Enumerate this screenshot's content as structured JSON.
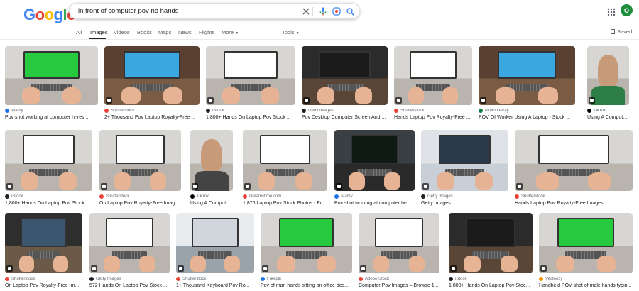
{
  "header": {
    "logo_letters": [
      {
        "ch": "G",
        "color": "#4285F4"
      },
      {
        "ch": "o",
        "color": "#EA4335"
      },
      {
        "ch": "o",
        "color": "#FBBC05"
      },
      {
        "ch": "g",
        "color": "#4285F4"
      },
      {
        "ch": "l",
        "color": "#34A853"
      },
      {
        "ch": "e",
        "color": "#EA4335"
      }
    ],
    "search_query": "in front of computer pov no hands",
    "avatar_letter": "O",
    "icons": [
      "clear-icon",
      "mic-icon",
      "lens-icon",
      "search-icon",
      "apps-icon"
    ]
  },
  "tabs": [
    {
      "label": "All",
      "active": false
    },
    {
      "label": "Images",
      "active": true
    },
    {
      "label": "Videos",
      "active": false
    },
    {
      "label": "Books",
      "active": false
    },
    {
      "label": "Maps",
      "active": false
    },
    {
      "label": "News",
      "active": false
    },
    {
      "label": "Flights",
      "active": false
    },
    {
      "label": "More",
      "active": false
    },
    {
      "label": "Tools",
      "active": false
    }
  ],
  "saved_label": "Saved",
  "rows": [
    {
      "cards": [
        {
          "source": "Alamy",
          "caption": "Pov shot working at computer hi-res ...",
          "scene": "green",
          "src_color": "#1a73e8"
        },
        {
          "source": "Shutterstock",
          "caption": "2+ Thousand Pov Laptop Royalty-Free ...",
          "scene": "blue",
          "src_color": "#ea4335"
        },
        {
          "source": "iStock",
          "caption": "1,800+ Hands On Laptop Pov Stock ...",
          "scene": "white",
          "src_color": "#202124"
        },
        {
          "source": "Getty Images",
          "caption": "Pov Desktop Computer Screen And ...",
          "scene": "dark",
          "src_color": "#202124"
        },
        {
          "source": "Shutterstock",
          "caption": "Hands Laptop Pov Royalty-Free ...",
          "scene": "white",
          "src_color": "#ea4335"
        },
        {
          "source": "Motion Array",
          "caption": "POV Of Worker Using A Laptop - Stock ...",
          "scene": "blue",
          "src_color": "#0b8043"
        },
        {
          "source": "TikTok",
          "caption": "Using A Computer ...",
          "scene": "person-green",
          "src_color": "#000000"
        }
      ]
    },
    {
      "cards": [
        {
          "source": "iStock",
          "caption": "1,800+ Hands On Laptop Pov Stock ...",
          "scene": "white",
          "src_color": "#202124"
        },
        {
          "source": "Shutterstock",
          "caption": "On Laptop Pov Royalty-Free Imag...",
          "scene": "white",
          "src_color": "#ea4335"
        },
        {
          "source": "TikTok",
          "caption": "Using A Computer ...",
          "scene": "person",
          "src_color": "#000000"
        },
        {
          "source": "Dreamstime.com",
          "caption": "1,876 Laptop Pov Stock Photos - Fr...",
          "scene": "white",
          "src_color": "#ea4335"
        },
        {
          "source": "Alamy",
          "caption": "Pov shot working at computer hi-...",
          "scene": "code",
          "src_color": "#1a73e8"
        },
        {
          "source": "Getty Images",
          "caption": "Getty Images",
          "scene": "silver",
          "src_color": "#202124"
        },
        {
          "source": "Shutterstock",
          "caption": "Hands Laptop Pov Royalty-Free Images ...",
          "scene": "white",
          "src_color": "#ea4335"
        }
      ]
    },
    {
      "cards": [
        {
          "source": "Shutterstock",
          "caption": "On Laptop Pov Royalty-Free Im...",
          "scene": "multi",
          "src_color": "#ea4335"
        },
        {
          "source": "Getty Images",
          "caption": "572 Hands On Laptop Pov Stock ...",
          "scene": "white",
          "src_color": "#202124"
        },
        {
          "source": "Shutterstock",
          "caption": "1+ Thousand Keyboard Pov Ro...",
          "scene": "desk",
          "src_color": "#ea4335"
        },
        {
          "source": "Freepik",
          "caption": "Pov of man hands sitting on office des...",
          "scene": "green",
          "src_color": "#1a73e8"
        },
        {
          "source": "Adobe Stock",
          "caption": "Computer Pov Images – Browse 1...",
          "scene": "white",
          "src_color": "#ea4335"
        },
        {
          "source": "iStock",
          "caption": "1,800+ Hands On Laptop Pov Stoc...",
          "scene": "dark",
          "src_color": "#202124"
        },
        {
          "source": "Vecteezy",
          "caption": "Handheld POV shot of male hands typin...",
          "scene": "green",
          "src_color": "#f29900"
        }
      ]
    }
  ]
}
